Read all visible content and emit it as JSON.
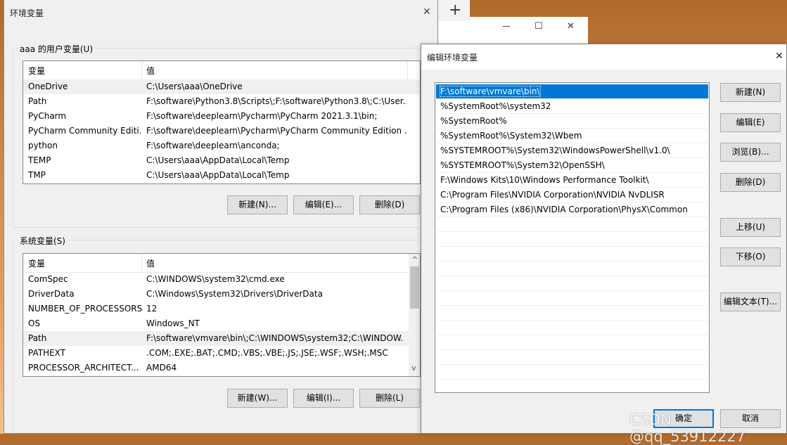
{
  "background": {
    "plus_icon": "+"
  },
  "back_window": {
    "controls": {
      "minimize": "—",
      "maximize": "☐",
      "close": "✕"
    }
  },
  "env_dialog": {
    "title": "环境变量",
    "close": "✕",
    "user_group": {
      "label": "aaa 的用户变量(U)",
      "columns": [
        "变量",
        "值"
      ],
      "rows": [
        {
          "name": "OneDrive",
          "value": "C:\\Users\\aaa\\OneDrive"
        },
        {
          "name": "Path",
          "value": "F:\\software\\Python3.8\\Scripts\\;F:\\software\\Python3.8\\;C:\\User..."
        },
        {
          "name": "PyCharm",
          "value": "F:\\software\\deeplearn\\Pycharm\\PyCharm 2021.3.1\\bin;"
        },
        {
          "name": "PyCharm Community Editi...",
          "value": "F:\\software\\deeplearn\\Pycharm\\PyCharm Community Edition ..."
        },
        {
          "name": "python",
          "value": "F:\\software\\deeplearn\\anconda;"
        },
        {
          "name": "TEMP",
          "value": "C:\\Users\\aaa\\AppData\\Local\\Temp"
        },
        {
          "name": "TMP",
          "value": "C:\\Users\\aaa\\AppData\\Local\\Temp"
        }
      ],
      "buttons": {
        "new": "新建(N)...",
        "edit": "编辑(E)...",
        "delete": "删除(D)"
      }
    },
    "system_group": {
      "label": "系统变量(S)",
      "columns": [
        "变量",
        "值"
      ],
      "rows": [
        {
          "name": "ComSpec",
          "value": "C:\\WINDOWS\\system32\\cmd.exe"
        },
        {
          "name": "DriverData",
          "value": "C:\\Windows\\System32\\Drivers\\DriverData"
        },
        {
          "name": "NUMBER_OF_PROCESSORS",
          "value": "12"
        },
        {
          "name": "OS",
          "value": "Windows_NT"
        },
        {
          "name": "Path",
          "value": "F:\\software\\vmvare\\bin\\;C:\\WINDOWS\\system32;C:\\WINDOW..."
        },
        {
          "name": "PATHEXT",
          "value": ".COM;.EXE;.BAT;.CMD;.VBS;.VBE;.JS;.JSE;.WSF;.WSH;.MSC"
        },
        {
          "name": "PROCESSOR_ARCHITECT...",
          "value": "AMD64"
        }
      ],
      "scroll_up": "^",
      "scroll_down": "v",
      "buttons": {
        "new": "新建(W)...",
        "edit": "编辑(I)...",
        "delete": "删除(L)"
      }
    }
  },
  "edit_dialog": {
    "title": "编辑环境变量",
    "close": "✕",
    "entries": [
      "F:\\software\\vmvare\\bin\\",
      "%SystemRoot%\\system32",
      "%SystemRoot%",
      "%SystemRoot%\\System32\\Wbem",
      "%SYSTEMROOT%\\System32\\WindowsPowerShell\\v1.0\\",
      "%SYSTEMROOT%\\System32\\OpenSSH\\",
      "F:\\Windows Kits\\10\\Windows Performance Toolkit\\",
      "C:\\Program Files\\NVIDIA Corporation\\NVIDIA NvDLISR",
      "C:\\Program Files (x86)\\NVIDIA Corporation\\PhysX\\Common"
    ],
    "buttons": {
      "new": "新建(N)",
      "edit": "编辑(E)",
      "browse": "浏览(B)...",
      "delete": "删除(D)",
      "move_up": "上移(U)",
      "move_down": "下移(O)",
      "edit_text": "编辑文本(T)...",
      "ok": "确定",
      "cancel": "取消"
    }
  },
  "watermark": "CSDN @qq_53912227"
}
